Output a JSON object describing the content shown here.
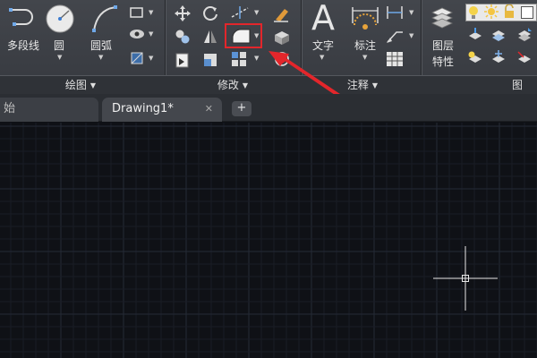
{
  "ribbon": {
    "draw_panel": {
      "title": "绘图",
      "tools": {
        "polyline": "多段线",
        "circle": "圆",
        "arc": "圆弧"
      }
    },
    "modify_panel": {
      "title": "修改"
    },
    "annotation_panel": {
      "title": "注释",
      "tools": {
        "text": "文字",
        "dimension": "标注",
        "text_icon_glyph": "A"
      }
    },
    "layers_panel": {
      "tools": {
        "layer_properties_line1": "图层",
        "layer_properties_line2": "特性"
      },
      "title_partial": "图"
    },
    "highlight_color": "#e3262b"
  },
  "tabs": {
    "start": "始",
    "active": "Drawing1*",
    "close_glyph": "✕",
    "new_tab_glyph": "+"
  },
  "canvas": {
    "background": "#0f1116",
    "grid_minor_color": "#1a1d25",
    "grid_major_color": "#242a36",
    "crosshair_color": "#e8e8e8"
  }
}
